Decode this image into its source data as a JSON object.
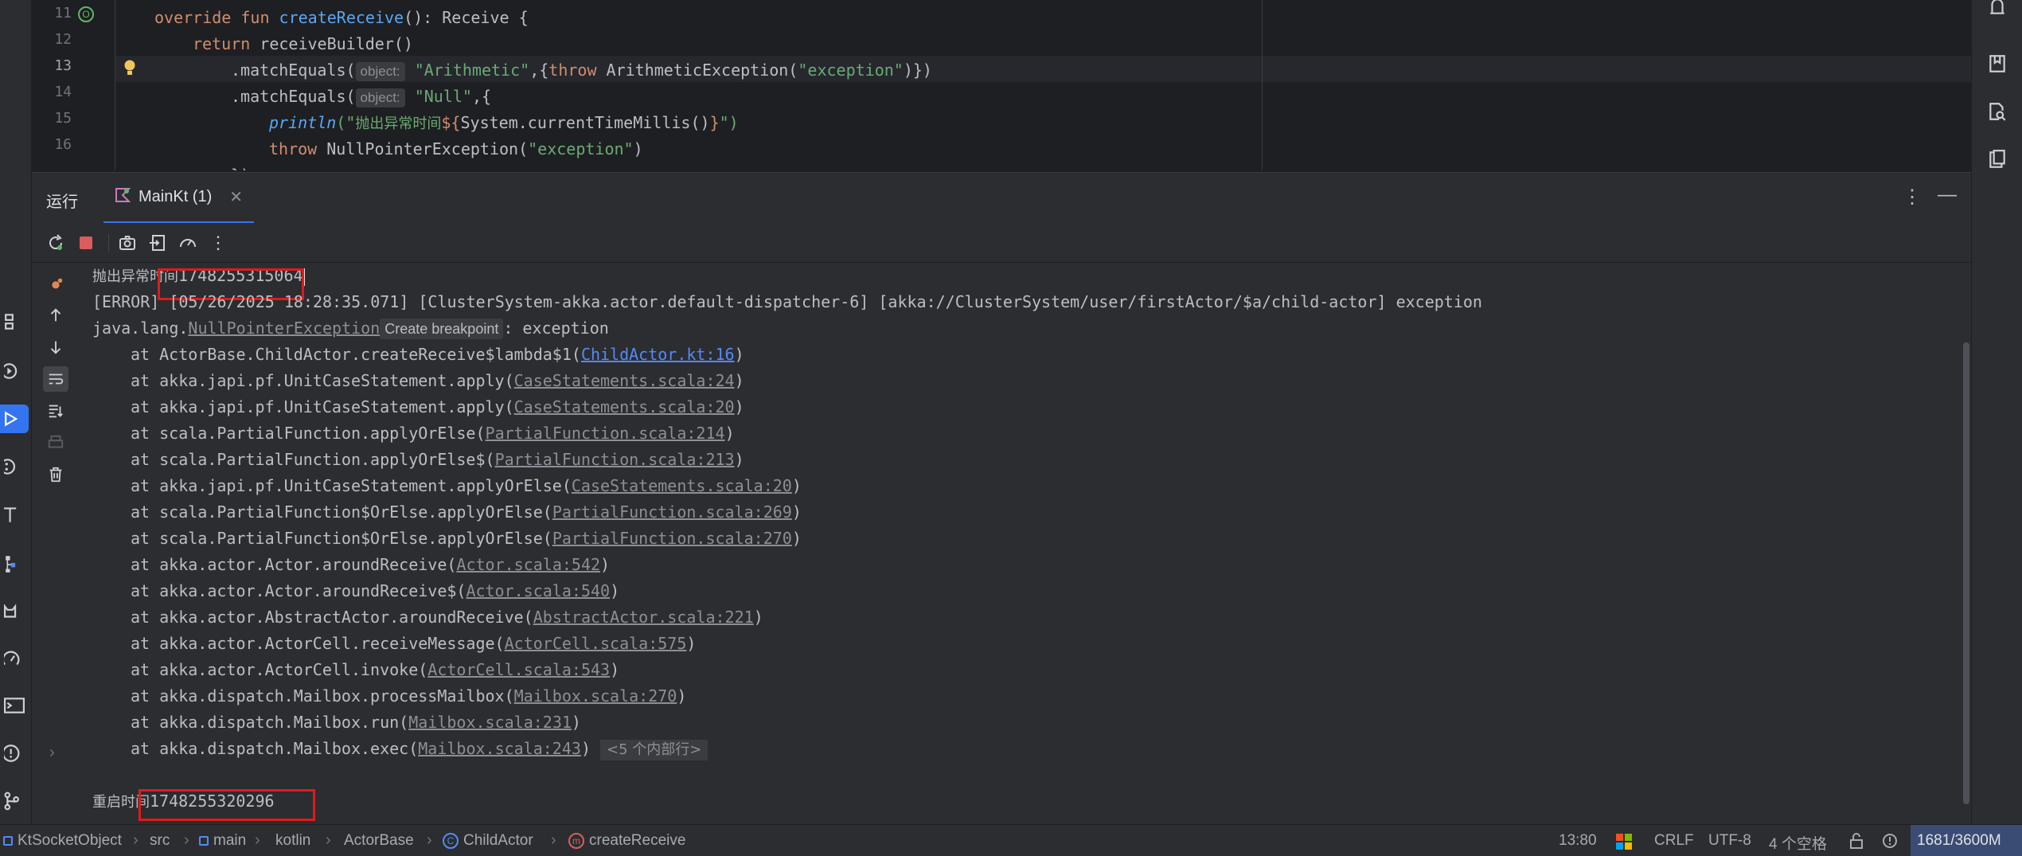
{
  "editor": {
    "line_numbers": [
      "11",
      "12",
      "13",
      "14",
      "15",
      "16"
    ],
    "line11": {
      "kw1": "override fun ",
      "fn": "createReceive",
      "rest": "(): Receive {"
    },
    "line12": {
      "kw": "return ",
      "rest": "receiveBuilder()"
    },
    "line13": {
      "pre": ".matchEquals(",
      "hint": "object:",
      "str": "\"Arithmetic\"",
      "mid": ",{",
      "kw": "throw ",
      "rest": "ArithmeticException(",
      "str2": "\"exception\"",
      "end": ")})"
    },
    "line14": {
      "pre": ".matchEquals(",
      "hint": "object:",
      "str": "\"Null\"",
      "end": ",{"
    },
    "line15": {
      "fn": "println",
      "open": "(\"",
      "str": "抛出异常时间",
      "interp": "${",
      "rest": "System.currentTimeMillis()",
      "interp_end": "}",
      "close": "\")"
    },
    "line16": {
      "kw": "throw ",
      "rest": "NullPointerException(",
      "str": "\"exception\"",
      "end": ")"
    },
    "line17_partial": "})"
  },
  "run_panel": {
    "title": "运行",
    "tab_label": "MainKt (1)",
    "close_glyph": "✕",
    "more_glyph": "⋮",
    "minimize_glyph": "—"
  },
  "console": {
    "line1_prefix": "抛出异常时间",
    "line1_value": "1748255315064",
    "error_line": "[ERROR] [05/26/2025 18:28:35.071] [ClusterSystem-akka.actor.default-dispatcher-6] [akka://ClusterSystem/user/firstActor/$a/child-actor] exception",
    "exception": {
      "pre": "java.lang.",
      "link": "NullPointerException",
      "bp": "Create breakpoint",
      "post": ": exception"
    },
    "stack": [
      {
        "text": "at ActorBase.ChildActor.createReceive$lambda$1(",
        "link": "ChildActor.kt:16",
        "blue": true
      },
      {
        "text": "at akka.japi.pf.UnitCaseStatement.apply(",
        "link": "CaseStatements.scala:24"
      },
      {
        "text": "at akka.japi.pf.UnitCaseStatement.apply(",
        "link": "CaseStatements.scala:20"
      },
      {
        "text": "at scala.PartialFunction.applyOrElse(",
        "link": "PartialFunction.scala:214"
      },
      {
        "text": "at scala.PartialFunction.applyOrElse$(",
        "link": "PartialFunction.scala:213"
      },
      {
        "text": "at akka.japi.pf.UnitCaseStatement.applyOrElse(",
        "link": "CaseStatements.scala:20"
      },
      {
        "text": "at scala.PartialFunction$OrElse.applyOrElse(",
        "link": "PartialFunction.scala:269"
      },
      {
        "text": "at scala.PartialFunction$OrElse.applyOrElse(",
        "link": "PartialFunction.scala:270"
      },
      {
        "text": "at akka.actor.Actor.aroundReceive(",
        "link": "Actor.scala:542"
      },
      {
        "text": "at akka.actor.Actor.aroundReceive$(",
        "link": "Actor.scala:540"
      },
      {
        "text": "at akka.actor.AbstractActor.aroundReceive(",
        "link": "AbstractActor.scala:221"
      },
      {
        "text": "at akka.actor.ActorCell.receiveMessage(",
        "link": "ActorCell.scala:575"
      },
      {
        "text": "at akka.actor.ActorCell.invoke(",
        "link": "ActorCell.scala:543"
      },
      {
        "text": "at akka.dispatch.Mailbox.processMailbox(",
        "link": "Mailbox.scala:270"
      },
      {
        "text": "at akka.dispatch.Mailbox.run(",
        "link": "Mailbox.scala:231"
      },
      {
        "text": "at akka.dispatch.Mailbox.exec(",
        "link": "Mailbox.scala:243",
        "fold": "<5 个内部行>"
      }
    ],
    "restart_prefix": "重启时间",
    "restart_value": "1748255320296",
    "expand_glyph": "›"
  },
  "status_bar": {
    "breadcrumbs": [
      "KtSocketObject",
      "src",
      "main",
      "kotlin",
      "ActorBase",
      "ChildActor",
      "createReceive"
    ],
    "position": "13:80",
    "line_sep": "CRLF",
    "encoding": "UTF-8",
    "indent": "4 个空格",
    "memory": "1681/3600M"
  },
  "colors": {
    "accent": "#3574f0",
    "highlight_box": "#e11a1a",
    "background": "#1e1f22",
    "panel": "#2b2d30"
  }
}
